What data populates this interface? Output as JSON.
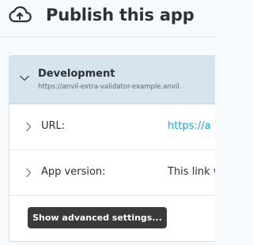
{
  "header": {
    "title": "Publish this app",
    "icon": "cloud-upload-icon"
  },
  "environment": {
    "name": "Development",
    "url": "https://anvil-extra-validator-example.anvil.",
    "expanded": true
  },
  "settings": [
    {
      "label": "URL:",
      "value": "https://a",
      "value_is_link": true
    },
    {
      "label": "App version:",
      "value": "This link w",
      "value_is_link": false
    }
  ],
  "advanced_button": {
    "label": "Show advanced settings..."
  },
  "colors": {
    "env_row_bg": "#d6e5ed",
    "link": "#1aa7e8",
    "button_bg": "#3a3a3a"
  }
}
